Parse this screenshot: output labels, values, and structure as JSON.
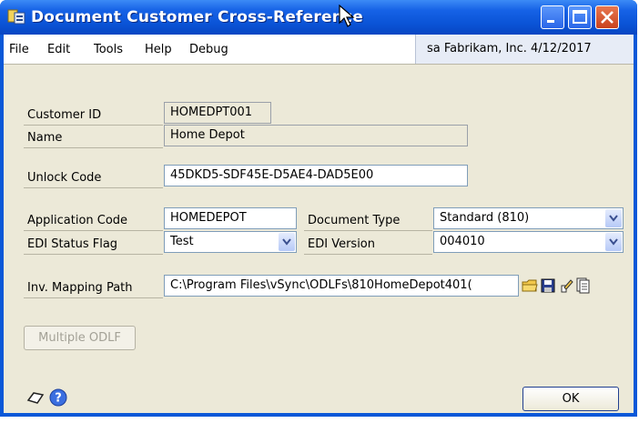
{
  "window": {
    "title": "Document Customer Cross-Reference"
  },
  "menu": [
    "File",
    "Edit",
    "Tools",
    "Help",
    "Debug"
  ],
  "status_bar": "sa  Fabrikam, Inc.  4/12/2017",
  "fields": {
    "customer_id": {
      "label": "Customer ID",
      "value": "HOMEDPT001"
    },
    "name": {
      "label": "Name",
      "value": "Home Depot"
    },
    "unlock_code": {
      "label": "Unlock Code",
      "value": "45DKD5-SDF45E-D5AE4-DAD5E00"
    },
    "application_code": {
      "label": "Application Code",
      "value": "HOMEDEPOT"
    },
    "document_type": {
      "label": "Document Type",
      "value": "Standard (810)"
    },
    "edi_status_flag": {
      "label": "EDI Status Flag",
      "value": "Test"
    },
    "edi_version": {
      "label": "EDI Version",
      "value": "004010"
    },
    "inv_mapping_path": {
      "label": "Inv. Mapping Path",
      "value": "C:\\Program Files\\vSync\\ODLFs\\810HomeDepot401("
    }
  },
  "buttons": {
    "multiple_odlf": "Multiple ODLF",
    "ok": "OK"
  },
  "colors": {
    "title_bar": "#0a53d6",
    "window_bg": "#ece9d8",
    "field_border": "#7f9db9"
  },
  "icons": [
    "folder-icon",
    "save-icon",
    "edit-icon",
    "document-icon",
    "note-icon",
    "help-icon",
    "close-icon",
    "minimize-icon",
    "maximize-icon"
  ]
}
